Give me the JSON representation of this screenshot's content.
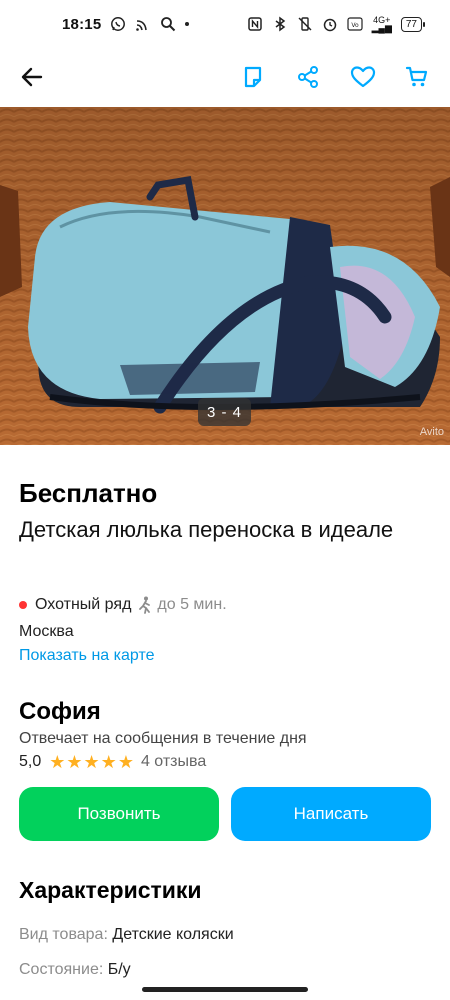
{
  "status_bar": {
    "time": "18:15",
    "network": "4G+",
    "battery": "77"
  },
  "gallery": {
    "counter": "3 - 4",
    "watermark": "Avito"
  },
  "listing": {
    "price": "Бесплатно",
    "title": "Детская люлька переноска в идеале",
    "metro_station": "Охотный ряд",
    "walk_time": "до 5 мин.",
    "city": "Москва",
    "map_link": "Показать на карте",
    "metro_color": "#ff3333"
  },
  "seller": {
    "name": "София",
    "response_time": "Отвечает на сообщения в течение дня",
    "rating": "5,0",
    "stars": 5,
    "reviews": "4 отзыва"
  },
  "actions": {
    "call_label": "Позвонить",
    "message_label": "Написать",
    "call_color": "#02d15c",
    "message_color": "#00aaff"
  },
  "characteristics": {
    "title": "Характеристики",
    "rows": [
      {
        "key": "Вид товара:",
        "value": "Детские коляски"
      },
      {
        "key": "Состояние:",
        "value": "Б/у"
      }
    ]
  },
  "icons": {
    "back": "arrow-left-icon",
    "note": "note-icon",
    "share": "share-icon",
    "favorite": "heart-icon",
    "cart": "cart-icon"
  }
}
